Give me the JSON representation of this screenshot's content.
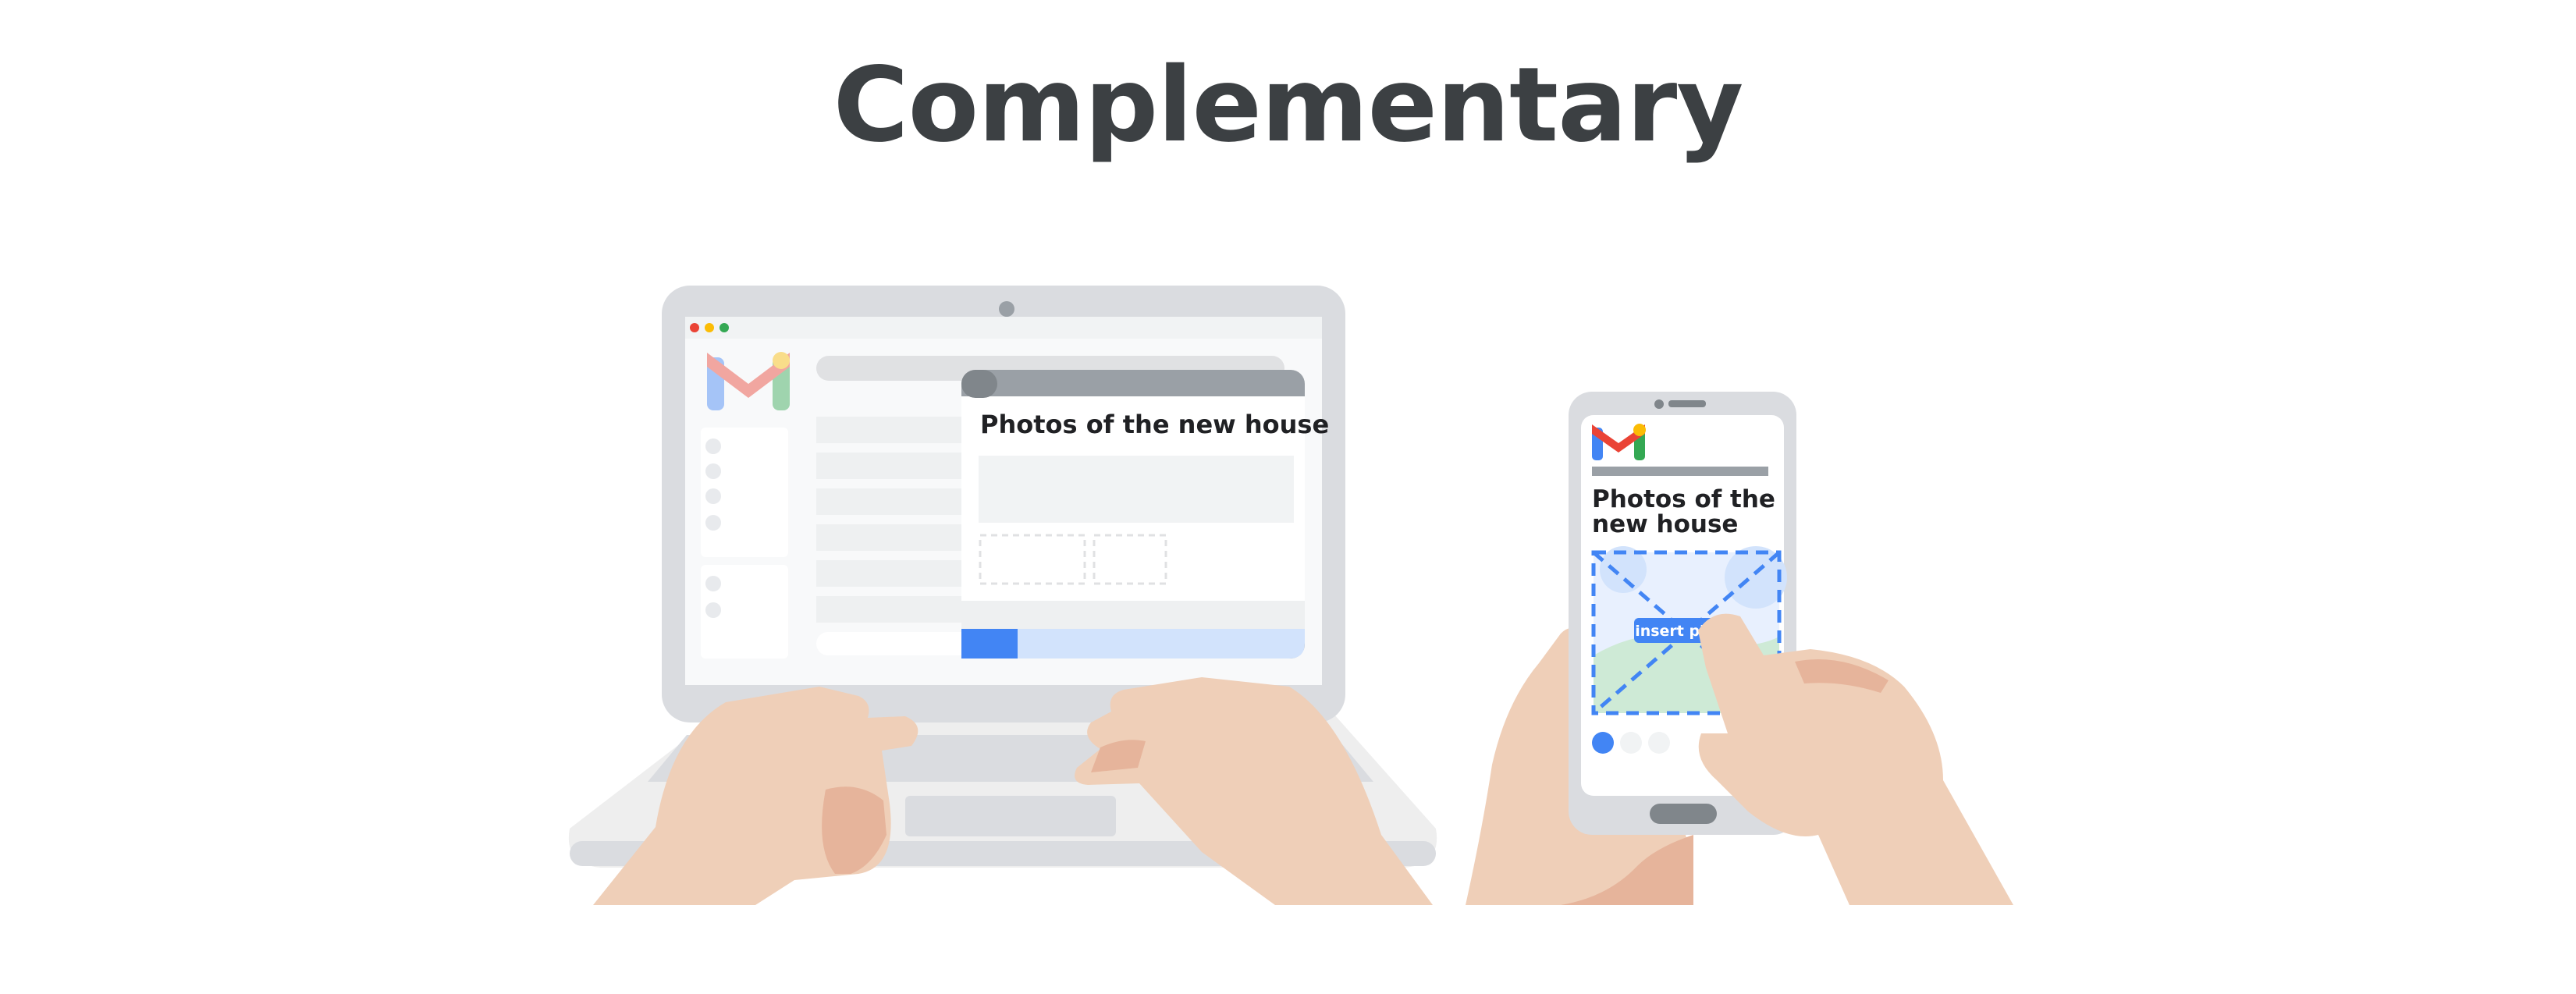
{
  "title": "Complementary",
  "laptop": {
    "compose_subject": "Photos of the new house",
    "window_dots": [
      "#ea4335",
      "#fbbc04",
      "#34a853"
    ]
  },
  "phone": {
    "subject_line1": "Photos of the",
    "subject_line2": "new house",
    "insert_photo_label": "insert photo"
  },
  "colors": {
    "accent_blue": "#4285f4",
    "skin": "#efcfb8",
    "skin_shadow": "#e6b49b",
    "device_gray": "#dadce0"
  }
}
